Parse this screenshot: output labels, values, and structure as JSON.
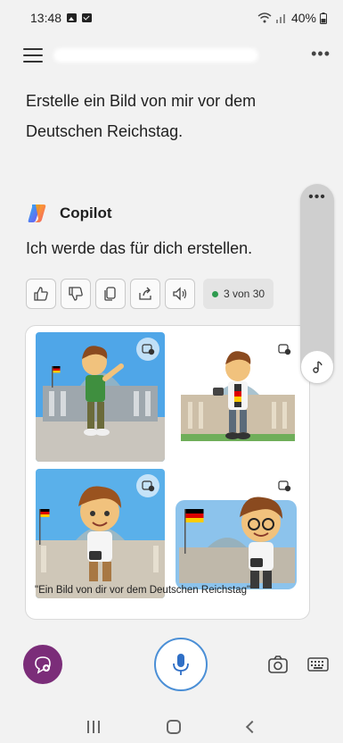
{
  "status_bar": {
    "time": "13:48",
    "battery": "40%"
  },
  "chat": {
    "user_message": "Erstelle ein Bild von mir vor dem Deutschen Reichstag.",
    "assistant_name": "Copilot",
    "assistant_reply": "Ich werde das für dich erstellen.",
    "counter": "3 von 30"
  },
  "gallery": {
    "caption": "\"Ein Bild von dir vor dem Deutschen Reichstag\""
  },
  "icons": {
    "menu": "hamburger-icon",
    "more": "more-icon",
    "thumbs_up": "thumbs-up-icon",
    "thumbs_down": "thumbs-down-icon",
    "copy": "copy-icon",
    "share": "share-icon",
    "read_aloud": "speaker-icon",
    "new_chat": "new-chat-icon",
    "mic": "microphone-icon",
    "camera": "camera-icon",
    "keyboard": "keyboard-icon"
  },
  "colors": {
    "accent_purple": "#7b2d79",
    "mic_ring": "#4b8fd6",
    "status_dot": "#2e9b4f"
  }
}
